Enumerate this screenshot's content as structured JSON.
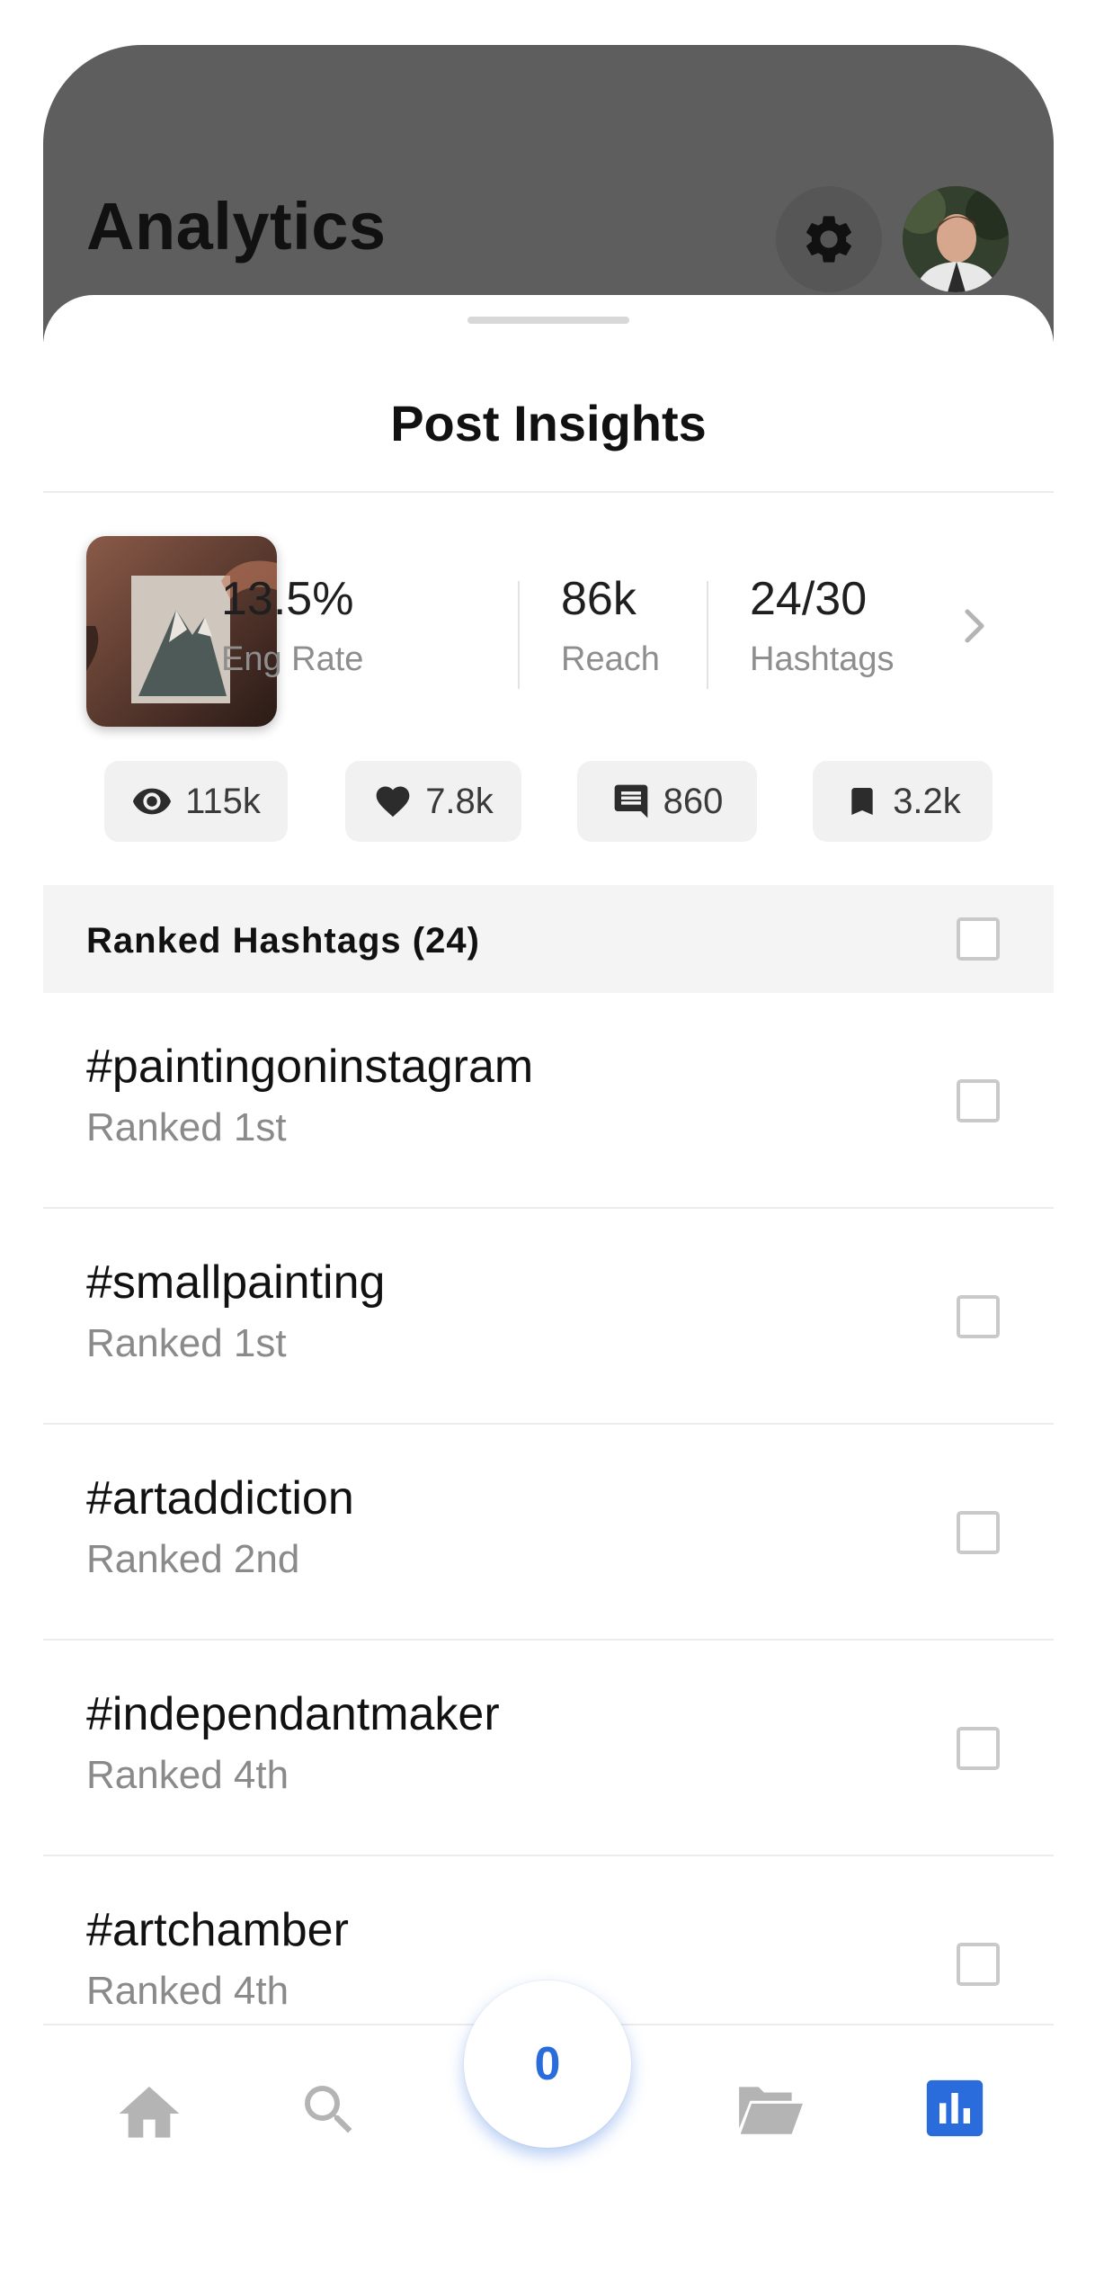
{
  "header": {
    "title": "Analytics"
  },
  "sheet": {
    "title": "Post Insights"
  },
  "stats": [
    {
      "value": "13.5%",
      "label": "Eng Rate"
    },
    {
      "value": "86k",
      "label": "Reach"
    },
    {
      "value": "24/30",
      "label": "Hashtags"
    }
  ],
  "metrics": {
    "views": "115k",
    "likes": "7.8k",
    "comments": "860",
    "saves": "3.2k"
  },
  "ranked": {
    "header": "Ranked Hashtags (24)",
    "items": [
      {
        "tag": "#paintingoninstagram",
        "rank": "Ranked 1st"
      },
      {
        "tag": "#smallpainting",
        "rank": "Ranked 1st"
      },
      {
        "tag": "#artaddiction",
        "rank": "Ranked 2nd"
      },
      {
        "tag": "#independantmaker",
        "rank": "Ranked 4th"
      },
      {
        "tag": "#artchamber",
        "rank": "Ranked 4th"
      }
    ]
  },
  "tabbar": {
    "fab_count": "0",
    "accent": "#2b6cdd",
    "tabs": [
      "home-icon",
      "search-icon",
      "folder-icon",
      "analytics-icon"
    ]
  }
}
